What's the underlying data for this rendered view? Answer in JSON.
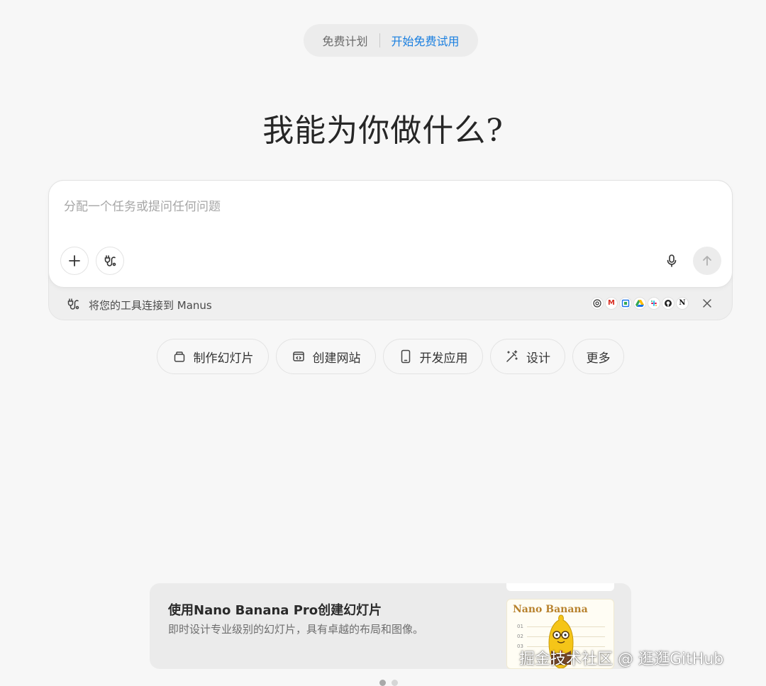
{
  "header": {
    "plan_label": "免费计划",
    "trial_label": "开始免费试用"
  },
  "headline": "我能为你做什么?",
  "composer": {
    "placeholder": "分配一个任务或提问任何问题",
    "plus_icon": "plus-icon",
    "connector_icon": "plug-icon",
    "mic_icon": "mic-icon",
    "send_icon": "arrow-up-icon"
  },
  "connect_bar": {
    "text": "将您的工具连接到 Manus",
    "tools": [
      "chrome",
      "gmail",
      "calendar",
      "drive",
      "slack",
      "github",
      "notion"
    ]
  },
  "chips": [
    {
      "label": "制作幻灯片",
      "icon": "slides-icon"
    },
    {
      "label": "创建网站",
      "icon": "code-window-icon"
    },
    {
      "label": "开发应用",
      "icon": "phone-icon"
    },
    {
      "label": "设计",
      "icon": "magic-wand-icon"
    },
    {
      "label": "更多",
      "icon": ""
    }
  ],
  "promo": {
    "title": "使用Nano Banana Pro创建幻灯片",
    "description": "即时设计专业级别的幻灯片，具有卓越的布局和图像。",
    "thumb_brand": "Nano Banana",
    "thumb_rows": [
      "01",
      "02",
      "03"
    ]
  },
  "watermark": "掘金技术社区 @ 逛逛GitHub",
  "colors": {
    "accent": "#1a7fe0",
    "background": "#f7f7f7"
  }
}
